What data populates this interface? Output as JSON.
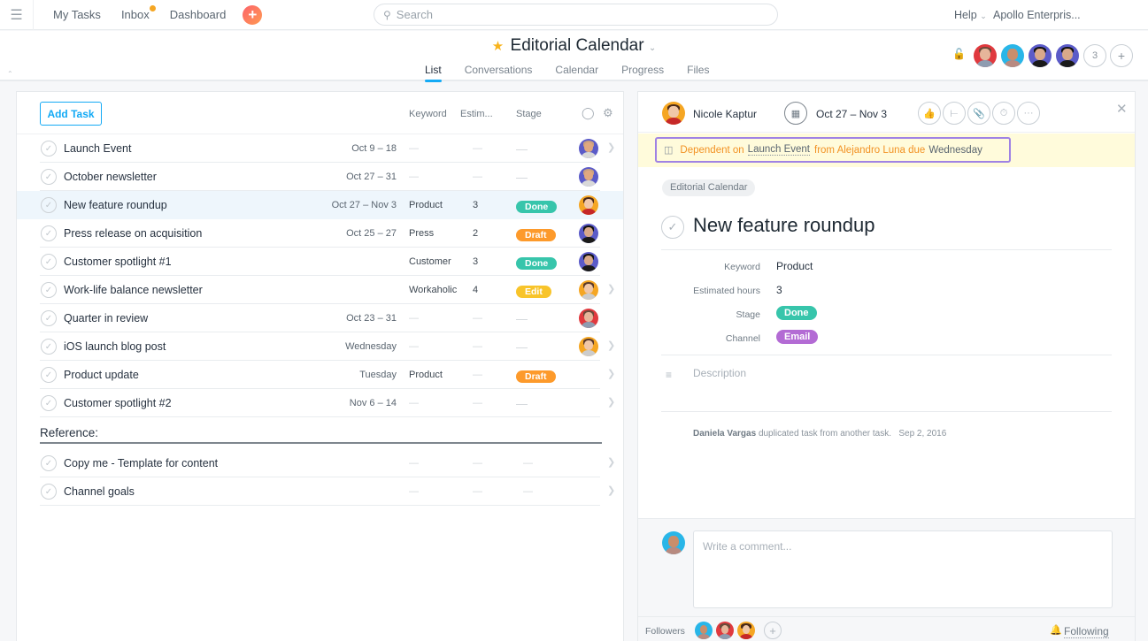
{
  "topbar": {
    "nav": [
      "My Tasks",
      "Inbox",
      "Dashboard"
    ],
    "inbox_has_unread": true,
    "search_placeholder": "Search",
    "help_label": "Help",
    "org_label": "Apollo Enterpris..."
  },
  "project": {
    "title": "Editorial Calendar",
    "starred": true,
    "tabs": [
      "List",
      "Conversations",
      "Calendar",
      "Progress",
      "Files"
    ],
    "active_tab": "List",
    "extra_members_count": "3"
  },
  "list": {
    "add_task_label": "Add Task",
    "columns": {
      "keyword": "Keyword",
      "estimate": "Estim...",
      "stage": "Stage"
    },
    "tasks": [
      {
        "name": "Launch Event",
        "date": "Oct 9 – 18",
        "keyword": "—",
        "estimate": "—",
        "stage": "",
        "assignee": "gray-man",
        "arrow": true
      },
      {
        "name": "October newsletter",
        "date": "Oct 27 – 31",
        "keyword": "—",
        "estimate": "—",
        "stage": "",
        "assignee": "gray-man",
        "arrow": false
      },
      {
        "name": "New feature roundup",
        "date": "Oct 27 – Nov 3",
        "keyword": "Product",
        "estimate": "3",
        "stage": "Done",
        "assignee": "yellow-woman",
        "arrow": false,
        "selected": true
      },
      {
        "name": "Press release on acquisition",
        "date": "Oct 25 – 27",
        "keyword": "Press",
        "estimate": "2",
        "stage": "Draft",
        "assignee": "purple-man",
        "arrow": false
      },
      {
        "name": "Customer spotlight #1",
        "date": "",
        "keyword": "Customer",
        "estimate": "3",
        "stage": "Done",
        "assignee": "purple-man",
        "arrow": false
      },
      {
        "name": "Work-life balance newsletter",
        "date": "",
        "keyword": "Workaholic",
        "estimate": "4",
        "stage": "Edit",
        "assignee": "yellow-woman2",
        "arrow": true
      },
      {
        "name": "Quarter in review",
        "date": "Oct 23 – 31",
        "keyword": "—",
        "estimate": "—",
        "stage": "",
        "assignee": "red-woman",
        "arrow": false
      },
      {
        "name": "iOS launch blog post",
        "date": "Wednesday",
        "keyword": "—",
        "estimate": "—",
        "stage": "",
        "assignee": "yellow-woman2",
        "arrow": true
      },
      {
        "name": "Product update",
        "date": "Tuesday",
        "keyword": "Product",
        "estimate": "—",
        "stage": "Draft",
        "assignee": "",
        "arrow": true
      },
      {
        "name": "Customer spotlight #2",
        "date": "Nov 6 – 14",
        "keyword": "—",
        "estimate": "—",
        "stage": "",
        "assignee": "",
        "arrow": true
      }
    ],
    "section_header": "Reference:",
    "reference_tasks": [
      {
        "name": "Copy me - Template for content",
        "keyword": "—",
        "estimate": "—",
        "stage": "—"
      },
      {
        "name": "Channel goals",
        "keyword": "—",
        "estimate": "—",
        "stage": "—"
      }
    ],
    "stage_colors": {
      "Done": "#37c5ab",
      "Draft": "#fd9a2b",
      "Edit": "#f8c42a"
    }
  },
  "detail": {
    "assignee": "Nicole Kaptur",
    "due": "Oct 27 – Nov 3",
    "dependency": {
      "prefix": "Dependent on",
      "task": "Launch Event",
      "middle": "from Alejandro Luna due",
      "due": "Wednesday"
    },
    "project_chip": "Editorial Calendar",
    "title": "New feature roundup",
    "fields": [
      {
        "label": "Keyword",
        "value": "Product"
      },
      {
        "label": "Estimated hours",
        "value": "3"
      },
      {
        "label": "Stage",
        "value": "Done"
      },
      {
        "label": "Channel",
        "value": "Email"
      }
    ],
    "colors": {
      "done": "#37c5ab",
      "email": "#b36bd4",
      "accent": "#14aaf5",
      "dependency_border": "#9f82e4",
      "dependency_text": "#f29224"
    },
    "description_placeholder": "Description",
    "story": {
      "actor": "Daniela Vargas",
      "text": "duplicated task from another task.",
      "date": "Sep 2, 2016"
    },
    "comment_placeholder": "Write a comment...",
    "followers_label": "Followers",
    "following_label": "Following"
  }
}
